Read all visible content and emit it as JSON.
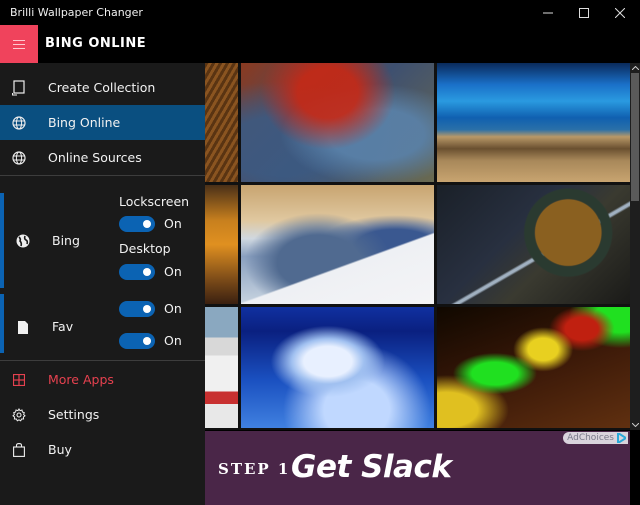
{
  "window": {
    "title": "Brilli Wallpaper Changer",
    "controls": {
      "minimize": "minimize",
      "maximize": "maximize",
      "close": "close"
    }
  },
  "header": {
    "menu_icon": "hamburger-icon",
    "title": "BING ONLINE",
    "accent_color": "#f0435c"
  },
  "sidebar": {
    "top_items": [
      {
        "label": "Create Collection",
        "icon": "collection-icon",
        "active": false
      },
      {
        "label": "Bing Online",
        "icon": "globe-icon",
        "active": true
      },
      {
        "label": "Online Sources",
        "icon": "globe-icon",
        "active": false
      }
    ],
    "sources": [
      {
        "label": "Bing",
        "icon": "world-icon",
        "toggles": [
          {
            "label": "Lockscreen",
            "state": "On",
            "on": true
          },
          {
            "label": "Desktop",
            "state": "On",
            "on": true
          }
        ]
      },
      {
        "label": "Fav",
        "icon": "page-icon",
        "toggles": [
          {
            "label": "",
            "state": "On",
            "on": true
          },
          {
            "label": "",
            "state": "On",
            "on": true
          }
        ]
      }
    ],
    "bottom_items": [
      {
        "label": "More Apps",
        "icon": "grid-icon",
        "highlight_color": "#e5414f"
      },
      {
        "label": "Settings",
        "icon": "gear-icon"
      },
      {
        "label": "Buy",
        "icon": "shopping-bag-icon"
      }
    ],
    "active_color": "#0a4f80",
    "toggle_color": "#0b63b3"
  },
  "gallery": {
    "tiles": [
      {
        "description": "wooden roof texture (partial)"
      },
      {
        "description": "abstract red and blue painting"
      },
      {
        "description": "blue wavy hills over field"
      },
      {
        "description": "golden cave interior (partial)"
      },
      {
        "description": "snowy mountain peaks with climbers"
      },
      {
        "description": "night city aerial with circular bridge"
      },
      {
        "description": "person in white outfit (partial)"
      },
      {
        "description": "frozen waterfall in blue forest"
      },
      {
        "description": "green and red bokeh lights"
      }
    ]
  },
  "ad": {
    "step_text": "STEP 1",
    "headline": "Get Slack",
    "adchoices_label": "AdChoices",
    "background_color": "#4a2648"
  }
}
